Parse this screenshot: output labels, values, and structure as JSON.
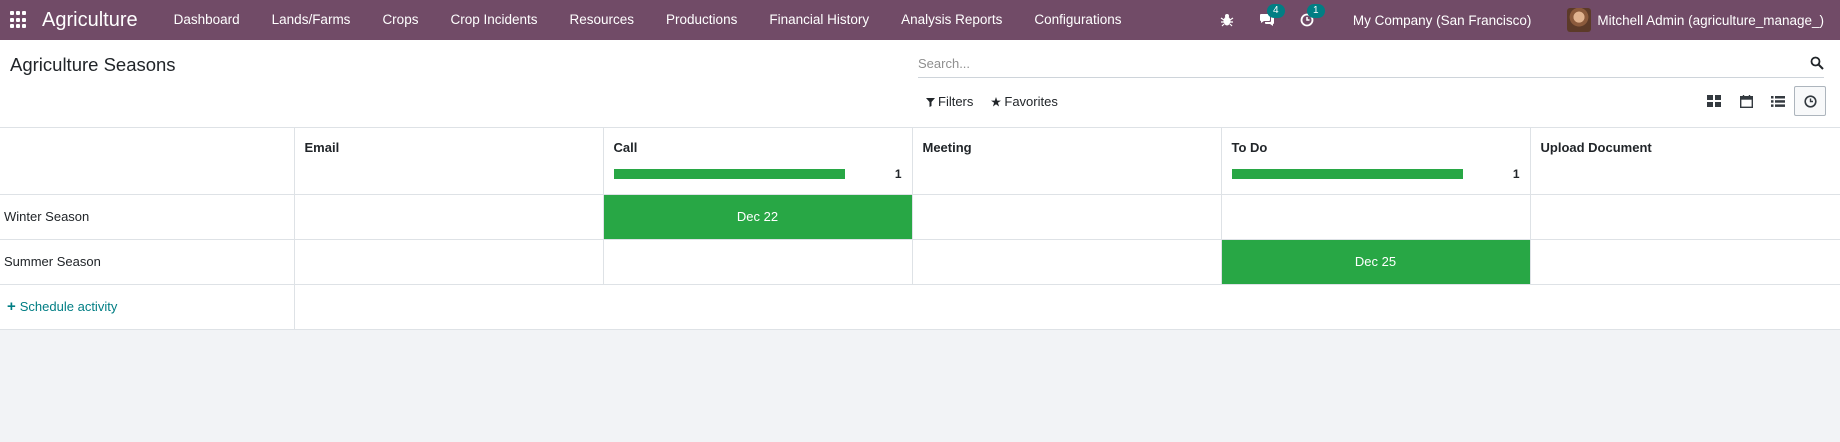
{
  "navbar": {
    "brand": "Agriculture",
    "menu": [
      "Dashboard",
      "Lands/Farms",
      "Crops",
      "Crop Incidents",
      "Resources",
      "Productions",
      "Financial History",
      "Analysis Reports",
      "Configurations"
    ],
    "messages_badge": "4",
    "activities_badge": "1",
    "company": "My Company (San Francisco)",
    "user": "Mitchell Admin (agriculture_manage_)"
  },
  "control_panel": {
    "title": "Agriculture Seasons",
    "search_placeholder": "Search...",
    "filters_label": "Filters",
    "favorites_label": "Favorites"
  },
  "activity": {
    "columns": [
      {
        "label": "Email",
        "count": "",
        "progress": 0
      },
      {
        "label": "Call",
        "count": "1",
        "progress": 1
      },
      {
        "label": "Meeting",
        "count": "",
        "progress": 0
      },
      {
        "label": "To Do",
        "count": "1",
        "progress": 1
      },
      {
        "label": "Upload Document",
        "count": "",
        "progress": 0
      }
    ],
    "rows": [
      {
        "name": "Winter Season",
        "cells": [
          "",
          "Dec 22",
          "",
          "",
          ""
        ]
      },
      {
        "name": "Summer Season",
        "cells": [
          "",
          "",
          "",
          "Dec 25",
          ""
        ]
      }
    ],
    "schedule_label": "Schedule activity"
  },
  "colors": {
    "brand": "#714b67",
    "planned": "#28a745",
    "link": "#017e84"
  }
}
